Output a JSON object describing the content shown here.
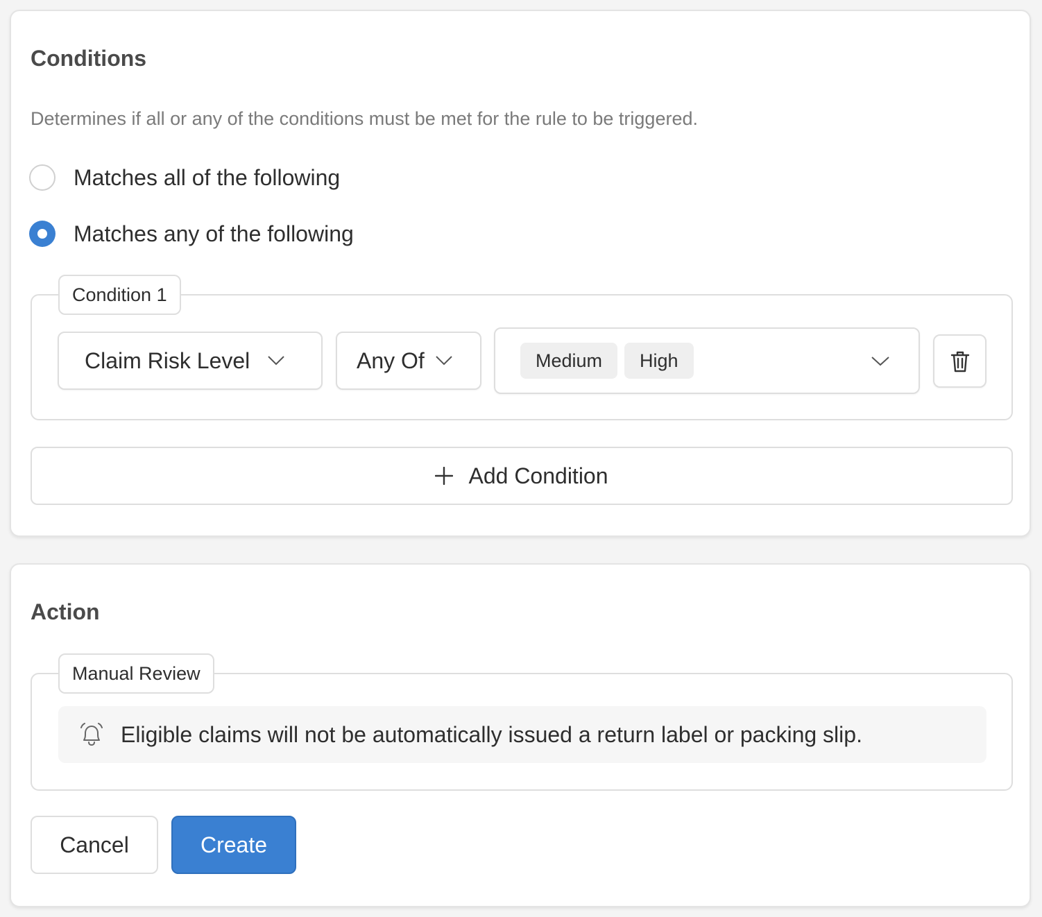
{
  "conditions": {
    "title": "Conditions",
    "description": "Determines if all or any of the conditions must be met for the rule to be triggered.",
    "options": [
      {
        "label": "Matches all of the following",
        "checked": false
      },
      {
        "label": "Matches any of the following",
        "checked": true
      }
    ],
    "condition1": {
      "legend": "Condition 1",
      "field": "Claim Risk Level",
      "operator": "Any Of",
      "values": [
        "Medium",
        "High"
      ],
      "delete_icon": "trash-icon"
    },
    "add_condition_label": "Add Condition",
    "add_icon": "plus-icon"
  },
  "action": {
    "title": "Action",
    "legend": "Manual Review",
    "notice_icon": "bell-icon",
    "notice": "Eligible claims will not be automatically issued a return label or packing slip."
  },
  "buttons": {
    "cancel": "Cancel",
    "create": "Create"
  },
  "colors": {
    "primary": "#3a80d2",
    "chip_bg": "#efefef",
    "border": "#dedede"
  }
}
